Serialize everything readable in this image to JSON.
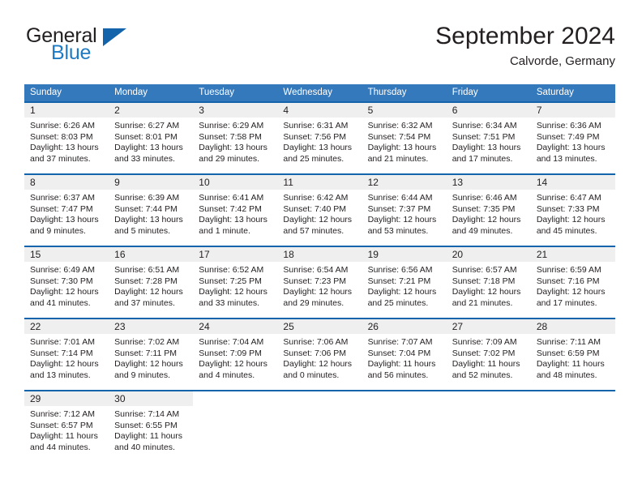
{
  "brand": {
    "word1": "General",
    "word2": "Blue",
    "triangle_icon": "triangle-icon",
    "accent_color": "#1464ab",
    "blue_text_color": "#1e7bc4"
  },
  "header": {
    "month_title": "September 2024",
    "location": "Calvorde, Germany"
  },
  "theme": {
    "header_bg": "#3579bd",
    "row_border": "#1464ab",
    "daynum_band": "#efefef",
    "text": "#231f20"
  },
  "weekdays": [
    "Sunday",
    "Monday",
    "Tuesday",
    "Wednesday",
    "Thursday",
    "Friday",
    "Saturday"
  ],
  "weeks": [
    [
      {
        "day": "1",
        "lines": [
          "Sunrise: 6:26 AM",
          "Sunset: 8:03 PM",
          "Daylight: 13 hours",
          "and 37 minutes."
        ]
      },
      {
        "day": "2",
        "lines": [
          "Sunrise: 6:27 AM",
          "Sunset: 8:01 PM",
          "Daylight: 13 hours",
          "and 33 minutes."
        ]
      },
      {
        "day": "3",
        "lines": [
          "Sunrise: 6:29 AM",
          "Sunset: 7:58 PM",
          "Daylight: 13 hours",
          "and 29 minutes."
        ]
      },
      {
        "day": "4",
        "lines": [
          "Sunrise: 6:31 AM",
          "Sunset: 7:56 PM",
          "Daylight: 13 hours",
          "and 25 minutes."
        ]
      },
      {
        "day": "5",
        "lines": [
          "Sunrise: 6:32 AM",
          "Sunset: 7:54 PM",
          "Daylight: 13 hours",
          "and 21 minutes."
        ]
      },
      {
        "day": "6",
        "lines": [
          "Sunrise: 6:34 AM",
          "Sunset: 7:51 PM",
          "Daylight: 13 hours",
          "and 17 minutes."
        ]
      },
      {
        "day": "7",
        "lines": [
          "Sunrise: 6:36 AM",
          "Sunset: 7:49 PM",
          "Daylight: 13 hours",
          "and 13 minutes."
        ]
      }
    ],
    [
      {
        "day": "8",
        "lines": [
          "Sunrise: 6:37 AM",
          "Sunset: 7:47 PM",
          "Daylight: 13 hours",
          "and 9 minutes."
        ]
      },
      {
        "day": "9",
        "lines": [
          "Sunrise: 6:39 AM",
          "Sunset: 7:44 PM",
          "Daylight: 13 hours",
          "and 5 minutes."
        ]
      },
      {
        "day": "10",
        "lines": [
          "Sunrise: 6:41 AM",
          "Sunset: 7:42 PM",
          "Daylight: 13 hours",
          "and 1 minute."
        ]
      },
      {
        "day": "11",
        "lines": [
          "Sunrise: 6:42 AM",
          "Sunset: 7:40 PM",
          "Daylight: 12 hours",
          "and 57 minutes."
        ]
      },
      {
        "day": "12",
        "lines": [
          "Sunrise: 6:44 AM",
          "Sunset: 7:37 PM",
          "Daylight: 12 hours",
          "and 53 minutes."
        ]
      },
      {
        "day": "13",
        "lines": [
          "Sunrise: 6:46 AM",
          "Sunset: 7:35 PM",
          "Daylight: 12 hours",
          "and 49 minutes."
        ]
      },
      {
        "day": "14",
        "lines": [
          "Sunrise: 6:47 AM",
          "Sunset: 7:33 PM",
          "Daylight: 12 hours",
          "and 45 minutes."
        ]
      }
    ],
    [
      {
        "day": "15",
        "lines": [
          "Sunrise: 6:49 AM",
          "Sunset: 7:30 PM",
          "Daylight: 12 hours",
          "and 41 minutes."
        ]
      },
      {
        "day": "16",
        "lines": [
          "Sunrise: 6:51 AM",
          "Sunset: 7:28 PM",
          "Daylight: 12 hours",
          "and 37 minutes."
        ]
      },
      {
        "day": "17",
        "lines": [
          "Sunrise: 6:52 AM",
          "Sunset: 7:25 PM",
          "Daylight: 12 hours",
          "and 33 minutes."
        ]
      },
      {
        "day": "18",
        "lines": [
          "Sunrise: 6:54 AM",
          "Sunset: 7:23 PM",
          "Daylight: 12 hours",
          "and 29 minutes."
        ]
      },
      {
        "day": "19",
        "lines": [
          "Sunrise: 6:56 AM",
          "Sunset: 7:21 PM",
          "Daylight: 12 hours",
          "and 25 minutes."
        ]
      },
      {
        "day": "20",
        "lines": [
          "Sunrise: 6:57 AM",
          "Sunset: 7:18 PM",
          "Daylight: 12 hours",
          "and 21 minutes."
        ]
      },
      {
        "day": "21",
        "lines": [
          "Sunrise: 6:59 AM",
          "Sunset: 7:16 PM",
          "Daylight: 12 hours",
          "and 17 minutes."
        ]
      }
    ],
    [
      {
        "day": "22",
        "lines": [
          "Sunrise: 7:01 AM",
          "Sunset: 7:14 PM",
          "Daylight: 12 hours",
          "and 13 minutes."
        ]
      },
      {
        "day": "23",
        "lines": [
          "Sunrise: 7:02 AM",
          "Sunset: 7:11 PM",
          "Daylight: 12 hours",
          "and 9 minutes."
        ]
      },
      {
        "day": "24",
        "lines": [
          "Sunrise: 7:04 AM",
          "Sunset: 7:09 PM",
          "Daylight: 12 hours",
          "and 4 minutes."
        ]
      },
      {
        "day": "25",
        "lines": [
          "Sunrise: 7:06 AM",
          "Sunset: 7:06 PM",
          "Daylight: 12 hours",
          "and 0 minutes."
        ]
      },
      {
        "day": "26",
        "lines": [
          "Sunrise: 7:07 AM",
          "Sunset: 7:04 PM",
          "Daylight: 11 hours",
          "and 56 minutes."
        ]
      },
      {
        "day": "27",
        "lines": [
          "Sunrise: 7:09 AM",
          "Sunset: 7:02 PM",
          "Daylight: 11 hours",
          "and 52 minutes."
        ]
      },
      {
        "day": "28",
        "lines": [
          "Sunrise: 7:11 AM",
          "Sunset: 6:59 PM",
          "Daylight: 11 hours",
          "and 48 minutes."
        ]
      }
    ],
    [
      {
        "day": "29",
        "lines": [
          "Sunrise: 7:12 AM",
          "Sunset: 6:57 PM",
          "Daylight: 11 hours",
          "and 44 minutes."
        ]
      },
      {
        "day": "30",
        "lines": [
          "Sunrise: 7:14 AM",
          "Sunset: 6:55 PM",
          "Daylight: 11 hours",
          "and 40 minutes."
        ]
      },
      {
        "day": "",
        "lines": []
      },
      {
        "day": "",
        "lines": []
      },
      {
        "day": "",
        "lines": []
      },
      {
        "day": "",
        "lines": []
      },
      {
        "day": "",
        "lines": []
      }
    ]
  ]
}
